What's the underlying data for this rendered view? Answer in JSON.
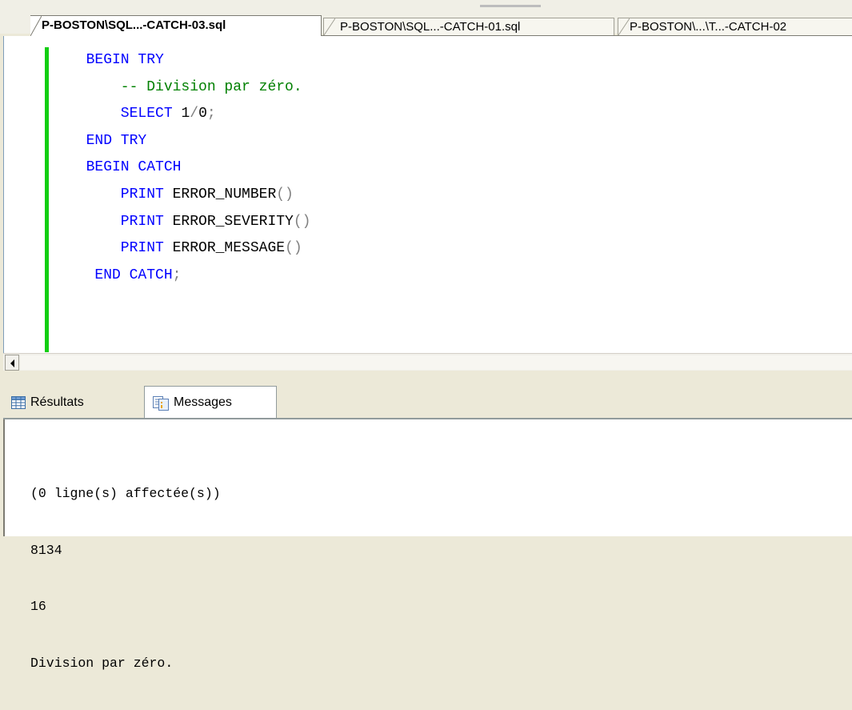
{
  "document_tabs": [
    {
      "label": "P-BOSTON\\SQL...-CATCH-03.sql",
      "active": true
    },
    {
      "label": "P-BOSTON\\SQL...-CATCH-01.sql",
      "active": false
    },
    {
      "label": "P-BOSTON\\...\\T...-CATCH-02",
      "active": false
    }
  ],
  "editor": {
    "lines": [
      [
        {
          "t": "kw",
          "v": "  BEGIN TRY"
        }
      ],
      [
        {
          "t": "cm",
          "v": "      -- Division par zéro."
        }
      ],
      [
        {
          "t": "kw",
          "v": "      SELECT "
        },
        {
          "t": "tx",
          "v": "1"
        },
        {
          "t": "pn",
          "v": "/"
        },
        {
          "t": "tx",
          "v": "0"
        },
        {
          "t": "pn",
          "v": ";"
        }
      ],
      [
        {
          "t": "kw",
          "v": "  END TRY"
        }
      ],
      [
        {
          "t": "kw",
          "v": "  BEGIN CATCH"
        }
      ],
      [
        {
          "t": "kw",
          "v": "      PRINT "
        },
        {
          "t": "tx",
          "v": "ERROR_NUMBER"
        },
        {
          "t": "pn",
          "v": "()"
        }
      ],
      [
        {
          "t": "kw",
          "v": "      PRINT "
        },
        {
          "t": "tx",
          "v": "ERROR_SEVERITY"
        },
        {
          "t": "pn",
          "v": "()"
        }
      ],
      [
        {
          "t": "kw",
          "v": "      PRINT "
        },
        {
          "t": "tx",
          "v": "ERROR_MESSAGE"
        },
        {
          "t": "pn",
          "v": "()"
        }
      ],
      [
        {
          "t": "kw",
          "v": "   END CATCH"
        },
        {
          "t": "pn",
          "v": ";"
        }
      ]
    ],
    "changed_indicator_color": "#13ce13"
  },
  "results_tabs": {
    "results_label": "Résultats",
    "messages_label": "Messages",
    "active": "messages"
  },
  "messages": {
    "lines": [
      "(0 ligne(s) affectée(s))",
      "8134",
      "16",
      "Division par zéro."
    ]
  },
  "icons": {
    "results": "grid-icon",
    "messages": "messages-icon",
    "scroll_left": "scroll-left-arrow-icon"
  },
  "colors": {
    "keyword": "#0000ff",
    "comment": "#008000",
    "text": "#000000",
    "punctuation": "#808080"
  }
}
